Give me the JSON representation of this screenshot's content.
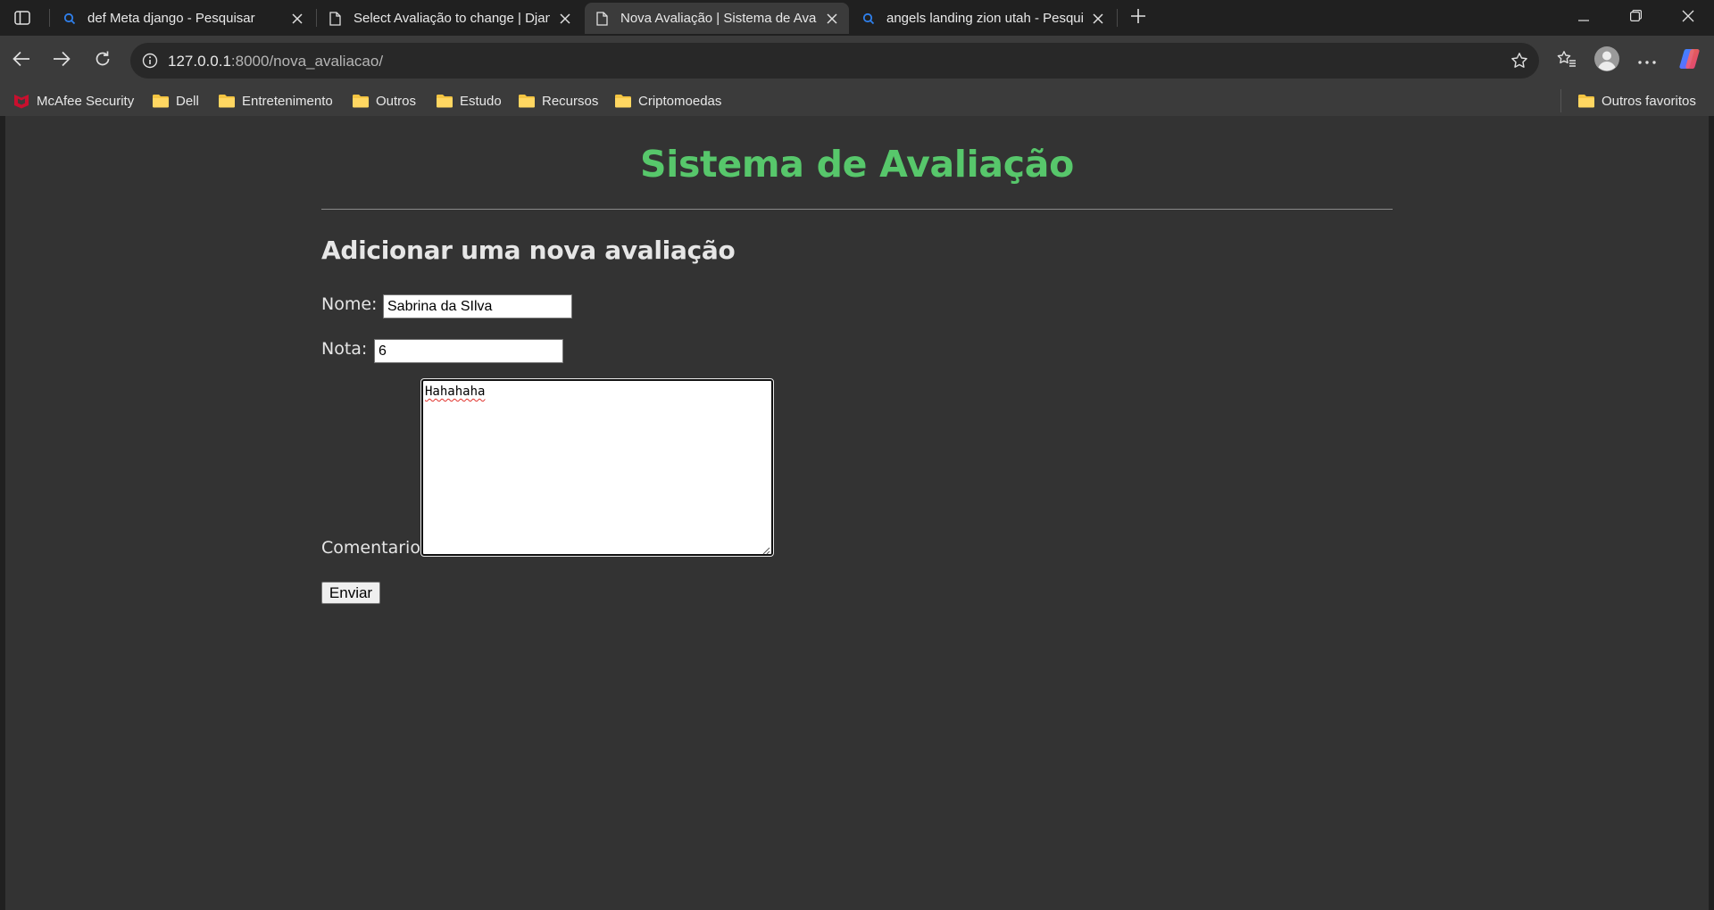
{
  "browser": {
    "tabs": [
      {
        "title": "def Meta django - Pesquisar",
        "favicon": "search-icon",
        "active": false
      },
      {
        "title": "Select Avaliação to change | Django site admin",
        "favicon": "page-icon",
        "active": false
      },
      {
        "title": "Nova Avaliação | Sistema de Avaliação",
        "favicon": "page-icon",
        "active": true
      },
      {
        "title": "angels landing zion utah - Pesquisar",
        "favicon": "search-icon",
        "active": false
      }
    ],
    "address": {
      "host": "127.0.0.1",
      "rest": ":8000/nova_avaliacao/"
    },
    "bookmarks": [
      {
        "label": "McAfee Security",
        "icon": "mcafee-icon"
      },
      {
        "label": "Dell",
        "icon": "folder-icon"
      },
      {
        "label": "Entretenimento",
        "icon": "folder-icon"
      },
      {
        "label": "Outros",
        "icon": "folder-icon"
      },
      {
        "label": "Estudo",
        "icon": "folder-icon"
      },
      {
        "label": "Recursos",
        "icon": "folder-icon"
      },
      {
        "label": "Criptomoedas",
        "icon": "folder-icon"
      }
    ],
    "other_favorites": "Outros favoritos"
  },
  "page": {
    "site_title": "Sistema de Avaliação",
    "form_title": "Adicionar uma nova avaliação",
    "fields": {
      "nome": {
        "label": "Nome:",
        "value": "Sabrina da SIlva"
      },
      "nota": {
        "label": "Nota:",
        "value": "6"
      },
      "comentario": {
        "label": "Comentario:",
        "value": "Hahahaha"
      }
    },
    "submit_label": "Enviar"
  },
  "colors": {
    "title_green": "#57c76b",
    "page_background": "#333333",
    "browser_chrome": "#3b3b3b",
    "folder_yellow": "#f4c542",
    "mcafee_red": "#c8102e"
  }
}
